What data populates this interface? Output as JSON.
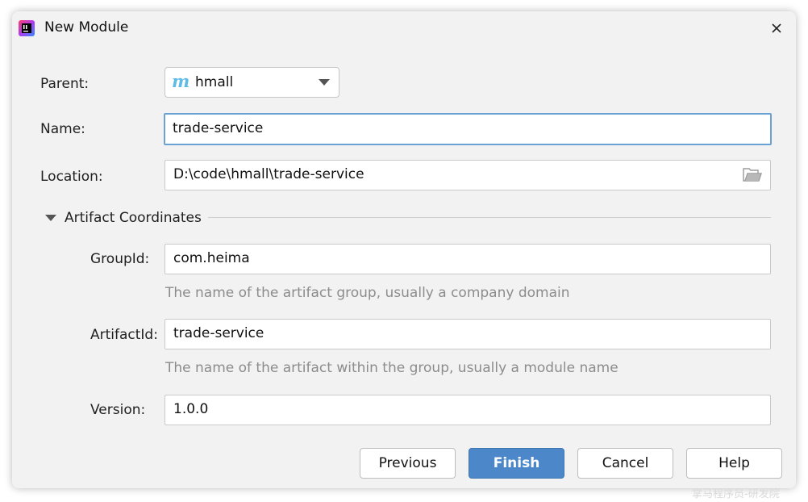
{
  "window": {
    "title": "New Module"
  },
  "form": {
    "parent": {
      "label": "Parent:",
      "value": "hmall",
      "icon_letter": "m"
    },
    "name": {
      "label": "Name:",
      "value": "trade-service"
    },
    "location": {
      "label": "Location:",
      "value": "D:\\code\\hmall\\trade-service"
    }
  },
  "artifact": {
    "section_title": "Artifact Coordinates",
    "group_id": {
      "label": "GroupId:",
      "value": "com.heima",
      "hint": "The name of the artifact group, usually a company domain"
    },
    "artifact_id": {
      "label": "ArtifactId:",
      "value": "trade-service",
      "hint": "The name of the artifact within the group, usually a module name"
    },
    "version": {
      "label": "Version:",
      "value": "1.0.0"
    }
  },
  "buttons": {
    "previous": "Previous",
    "finish": "Finish",
    "cancel": "Cancel",
    "help": "Help"
  },
  "watermark": "掌马程序员-研发院",
  "colors": {
    "dialog_background": "#f2f2f2",
    "primary_button": "#4c88c9",
    "focus_border": "#6aa2d6",
    "maven_icon": "#5ebbe6",
    "hint_text": "#8c8c8c"
  },
  "icons": {
    "app": "intellij-idea-icon",
    "close": "close-icon",
    "parent": "maven-module-icon",
    "dropdown": "chevron-down-icon",
    "browse": "folder-open-icon",
    "section": "triangle-down-icon"
  }
}
